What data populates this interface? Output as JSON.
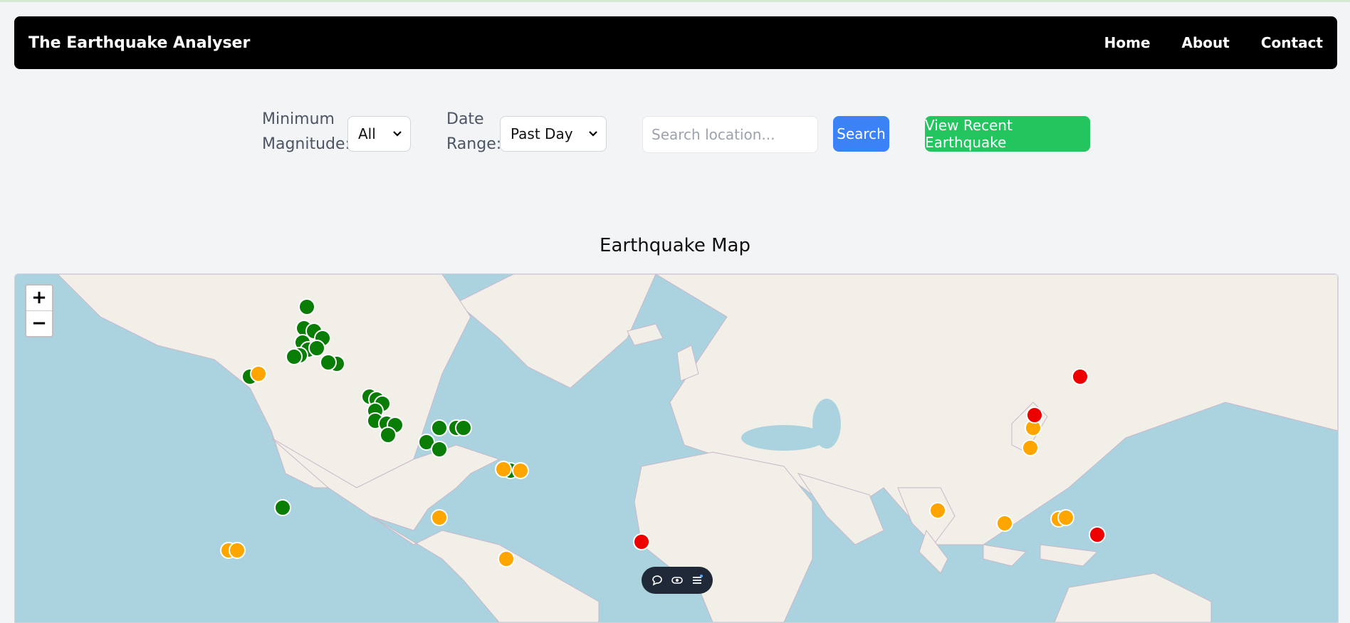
{
  "navbar": {
    "brand": "The Earthquake Analyser",
    "links": [
      "Home",
      "About",
      "Contact"
    ]
  },
  "controls": {
    "min_magnitude_label_1": "Minimum",
    "min_magnitude_label_2": "Magnitude:",
    "min_magnitude_value": "All",
    "date_range_label_1": "Date",
    "date_range_label_2": "Range:",
    "date_range_value": "Past Day",
    "search_placeholder": "Search location...",
    "search_button": "Search",
    "recent_button": "View Recent Earthquake"
  },
  "map": {
    "title": "Earthquake Map",
    "zoom_in": "+",
    "zoom_out": "−",
    "marker_colors": {
      "green": "#0a7d06",
      "orange": "#ffa500",
      "red": "#ee0000"
    }
  },
  "floating_toolbar": {
    "icons": [
      "chat-icon",
      "eye-icon",
      "list-icon"
    ]
  }
}
